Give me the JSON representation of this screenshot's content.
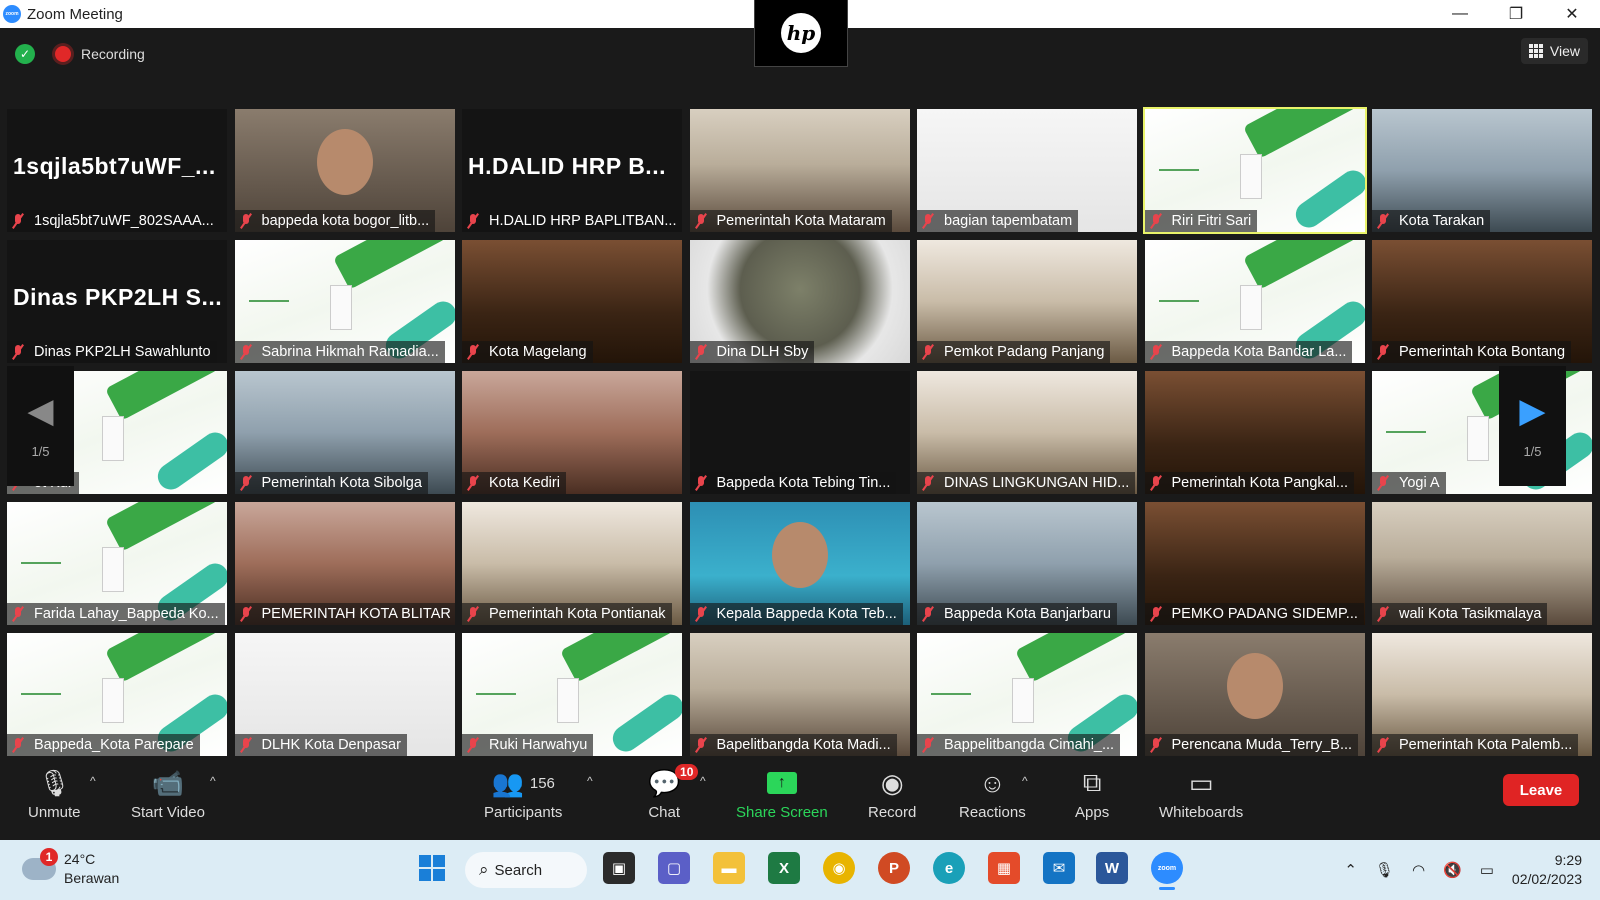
{
  "window": {
    "title": "Zoom Meeting",
    "controls": [
      "—",
      "❐",
      "✕"
    ]
  },
  "camera_brand": "hp",
  "meeting_bar": {
    "recording_label": "Recording",
    "view_label": "View"
  },
  "participants": [
    {
      "name": "1sqjla5bt7uWF_802SAAA...",
      "display_name": "1sqjla5bt7uWF_...",
      "video": "off",
      "bg": "dark"
    },
    {
      "name": "bappeda kota bogor_litb...",
      "video": "on",
      "bg": "person"
    },
    {
      "name": "H.DALID HRP BAPLITBAN...",
      "display_name": "H.DALID HRP B...",
      "video": "off",
      "bg": "dark"
    },
    {
      "name": "Pemerintah Kota Mataram",
      "video": "on",
      "bg": "room"
    },
    {
      "name": "bagian tapembatam",
      "video": "on",
      "bg": "white"
    },
    {
      "name": "Riri Fitri Sari",
      "video": "on",
      "bg": "slide",
      "active_speaker": true
    },
    {
      "name": "Kota Tarakan",
      "video": "on",
      "bg": "room3"
    },
    {
      "name": "Dinas PKP2LH Sawahlunto",
      "display_name": "Dinas PKP2LH S...",
      "video": "off",
      "bg": "dark"
    },
    {
      "name": "Sabrina Hikmah Ramadia...",
      "video": "on",
      "bg": "slide"
    },
    {
      "name": "Kota Magelang",
      "video": "on",
      "bg": "wood"
    },
    {
      "name": "Dina DLH Sby",
      "video": "on",
      "bg": "blurry"
    },
    {
      "name": "Pemkot Padang Panjang",
      "video": "on",
      "bg": "room2"
    },
    {
      "name": "Bappeda Kota Bandar La...",
      "video": "on",
      "bg": "slide"
    },
    {
      "name": "Pemerintah Kota Bontang",
      "video": "on",
      "bg": "wood"
    },
    {
      "name": "ot Kdr",
      "video": "on",
      "bg": "slide"
    },
    {
      "name": "Pemerintah Kota Sibolga",
      "video": "on",
      "bg": "room3"
    },
    {
      "name": "Kota Kediri",
      "video": "on",
      "bg": "room4"
    },
    {
      "name": "Bappeda Kota Tebing Tin...",
      "video": "on",
      "bg": "dark"
    },
    {
      "name": "DINAS LINGKUNGAN HID...",
      "video": "on",
      "bg": "room2"
    },
    {
      "name": "Pemerintah Kota Pangkal...",
      "video": "on",
      "bg": "wood"
    },
    {
      "name": "Yogi A",
      "video": "on",
      "bg": "slide"
    },
    {
      "name": "Farida Lahay_Bappeda Ko...",
      "video": "on",
      "bg": "slide"
    },
    {
      "name": "PEMERINTAH KOTA BLITAR",
      "video": "on",
      "bg": "room4"
    },
    {
      "name": "Pemerintah Kota Pontianak",
      "video": "on",
      "bg": "room2"
    },
    {
      "name": "Kepala Bappeda Kota Teb...",
      "video": "on",
      "bg": "blue"
    },
    {
      "name": "Bappeda Kota Banjarbaru",
      "video": "on",
      "bg": "room3"
    },
    {
      "name": "PEMKO PADANG SIDEMP...",
      "video": "on",
      "bg": "wood"
    },
    {
      "name": "wali Kota Tasikmalaya",
      "video": "on",
      "bg": "room"
    },
    {
      "name": "Bappeda_Kota Parepare",
      "video": "on",
      "bg": "slide"
    },
    {
      "name": "DLHK Kota Denpasar",
      "video": "on",
      "bg": "white"
    },
    {
      "name": "Ruki Harwahyu",
      "video": "on",
      "bg": "slide"
    },
    {
      "name": "Bapelitbangda Kota Madi...",
      "video": "on",
      "bg": "room"
    },
    {
      "name": "Bappelitbangda Cimahi_...",
      "video": "on",
      "bg": "slide"
    },
    {
      "name": "Perencana Muda_Terry_B...",
      "video": "on",
      "bg": "person"
    },
    {
      "name": "Pemerintah Kota Palemb...",
      "video": "on",
      "bg": "room2"
    }
  ],
  "pagination": {
    "left": "1/5",
    "right": "1/5"
  },
  "toolbar": {
    "unmute": "Unmute",
    "start_video": "Start Video",
    "participants": "Participants",
    "participants_count": "156",
    "chat": "Chat",
    "chat_badge": "10",
    "share_screen": "Share Screen",
    "record": "Record",
    "reactions": "Reactions",
    "apps": "Apps",
    "whiteboards": "Whiteboards",
    "leave": "Leave"
  },
  "taskbar": {
    "weather_temp": "24°C",
    "weather_desc": "Berawan",
    "weather_badge": "1",
    "search_label": "Search",
    "time": "9:29",
    "date": "02/02/2023"
  },
  "colors": {
    "active_speaker_border": "#e9f36a",
    "share_green": "#2bd65a",
    "leave_red": "#e02424",
    "muted_red": "#e8444c",
    "nav_arrow_blue": "#3aa0ff"
  }
}
